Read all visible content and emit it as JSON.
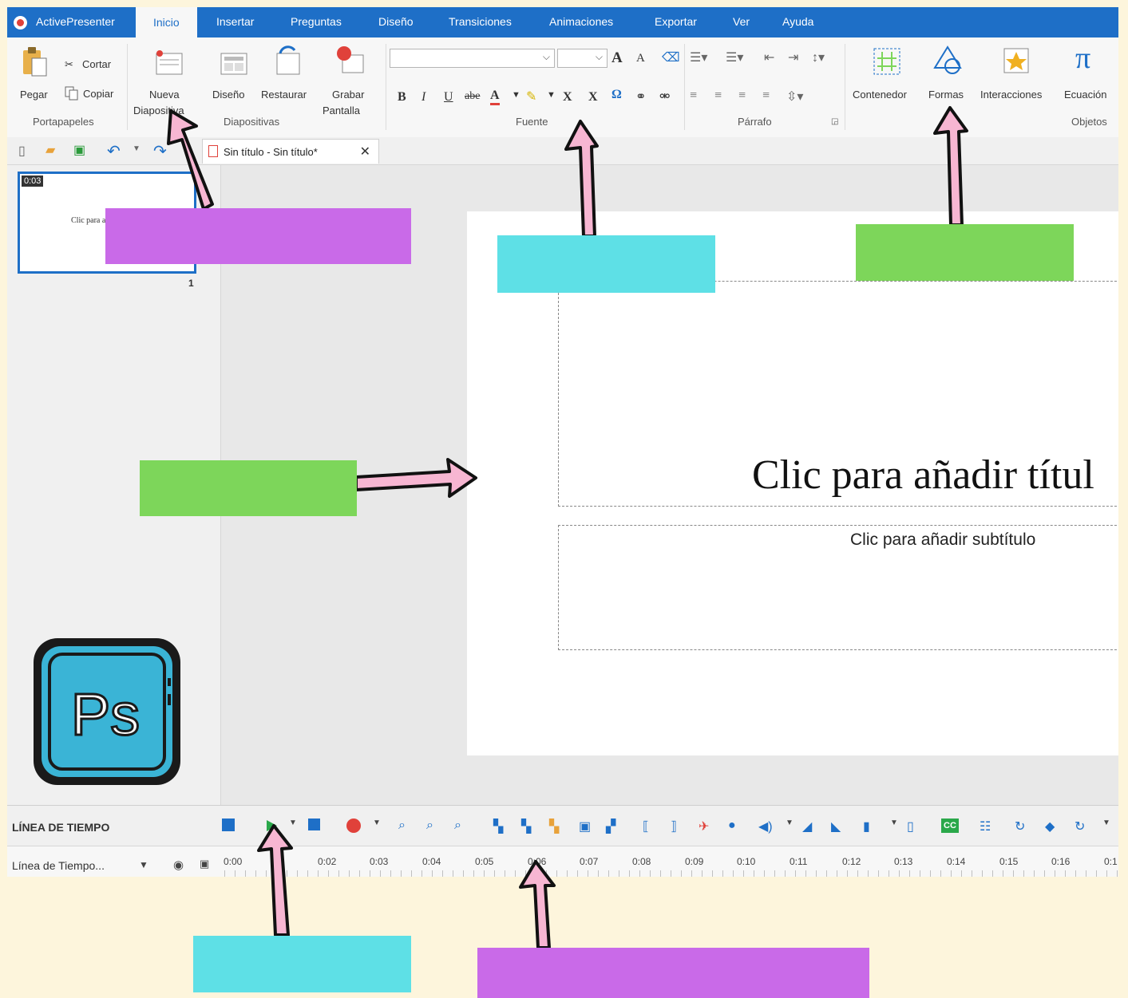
{
  "app": {
    "name": "ActivePresenter"
  },
  "menu": {
    "tabs": [
      "Inicio",
      "Insertar",
      "Preguntas",
      "Diseño",
      "Transiciones",
      "Animaciones",
      "Exportar",
      "Ver",
      "Ayuda"
    ]
  },
  "ribbon": {
    "clipboard": {
      "paste": "Pegar",
      "cut": "Cortar",
      "copy": "Copiar",
      "group": "Portapapeles"
    },
    "slides": {
      "new_slide_1": "Nueva",
      "new_slide_2": "Diapositiva",
      "layout": "Diseño",
      "reset": "Restaurar",
      "record_1": "Grabar",
      "record_2": "Pantalla",
      "group": "Diapositivas"
    },
    "font": {
      "group": "Fuente",
      "bold": "B",
      "italic": "I",
      "underline": "U",
      "strike": "abe",
      "color_letter": "A",
      "superscript": "X",
      "subscript": "X",
      "omega": "Ω"
    },
    "paragraph": {
      "group": "Párrafo"
    },
    "objects": {
      "container": "Contenedor",
      "shapes": "Formas",
      "interactions": "Interacciones",
      "equation": "Ecuación",
      "equation_symbol": "π",
      "group": "Objetos"
    }
  },
  "document": {
    "tab_title": "Sin título - Sin título*",
    "close": "✕"
  },
  "thumbnail": {
    "time": "0:03",
    "title": "Clic para a",
    "number": "1"
  },
  "slide": {
    "title_placeholder": "Clic para añadir títul",
    "subtitle_placeholder": "Clic para añadir subtítulo"
  },
  "timeline": {
    "title": "LÍNEA DE TIEMPO",
    "track": "Línea de Tiempo...",
    "cc": "CC",
    "ticks": [
      "0:00",
      "0:02",
      "0:03",
      "0:04",
      "0:05",
      "0:06",
      "0:07",
      "0:08",
      "0:09",
      "0:10",
      "0:11",
      "0:12",
      "0:13",
      "0:14",
      "0:15",
      "0:16",
      "0:1"
    ]
  },
  "colors": {
    "accent": "#1e6fc7",
    "background": "#fdf5dc",
    "purple_box": "#c96ae8",
    "cyan_box": "#5ee0e6",
    "green_box": "#7dd65a",
    "arrow_fill": "#f7b6d2",
    "ps_blue": "#3ab4d6"
  },
  "icons": {
    "photoshop_logo_text": "Ps"
  }
}
